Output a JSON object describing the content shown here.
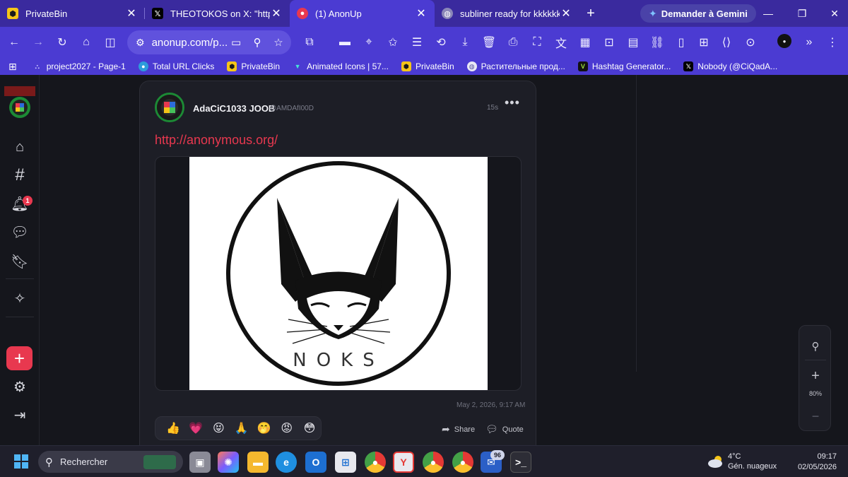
{
  "browser": {
    "tabs": [
      {
        "title": "PrivateBin",
        "favicon": "privatebin-favicon",
        "active": false
      },
      {
        "title": "THEOTOKOS on X: \"https://t",
        "favicon": "x-favicon",
        "active": false
      },
      {
        "title": "(1) AnonUp",
        "favicon": "anonup-favicon",
        "active": true
      },
      {
        "title": "subliner ready for kkkkkk",
        "favicon": "globe-favicon",
        "active": false
      }
    ],
    "gemini_label": "Demander à Gemini",
    "url": "anonup.com/p...",
    "bookmarks": [
      {
        "label": "project2027 - Page-1"
      },
      {
        "label": "Total URL Clicks"
      },
      {
        "label": "PrivateBin"
      },
      {
        "label": "Animated Icons | 57..."
      },
      {
        "label": "PrivateBin"
      },
      {
        "label": "Растительные прод..."
      },
      {
        "label": "Hashtag Generator..."
      },
      {
        "label": "Nobody (@CiQadA..."
      }
    ]
  },
  "nav": {
    "notification_count": "1"
  },
  "post": {
    "username": "AdaCiC1033 JOOB",
    "handle": "@AMDAfI00D",
    "time": "15s",
    "link": "http://anonymous.org/",
    "image_text": "NOKS",
    "date": "May 2, 2026, 9:17 AM",
    "reactions": [
      "👍",
      "💗",
      "😝",
      "🙏",
      "🤭",
      "😡",
      "😳"
    ],
    "share_label": "Share",
    "quote_label": "Quote"
  },
  "zoom": {
    "level": "80%"
  },
  "taskbar": {
    "search_placeholder": "Rechercher",
    "mail_badge": "96",
    "weather_temp": "4°C",
    "weather_desc": "Gén. nuageux",
    "time": "09:17",
    "date": "02/05/2026"
  },
  "colors": {
    "accent": "#e8384f",
    "browser": "#4b3bd2",
    "tabstrip": "#3a2a9e"
  }
}
